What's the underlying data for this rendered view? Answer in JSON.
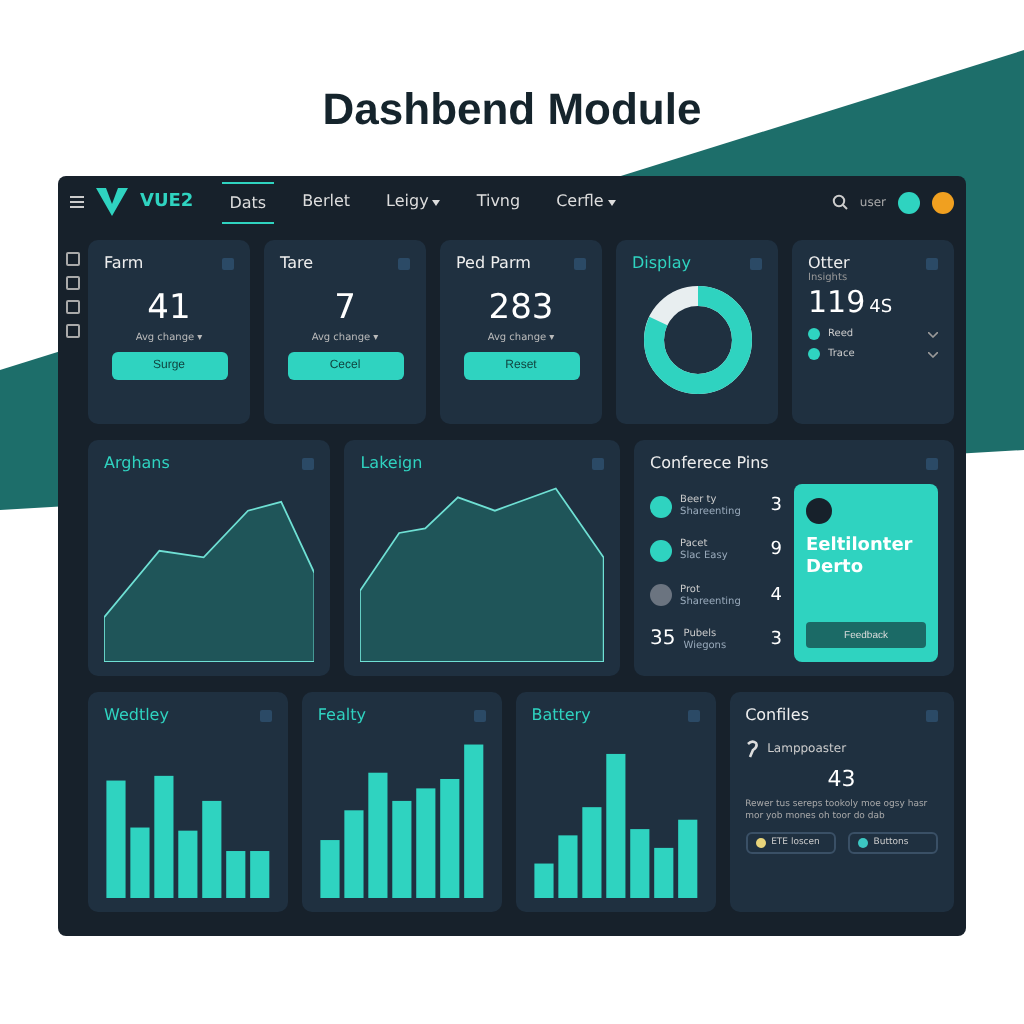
{
  "title": "Dashbend Module",
  "nav": {
    "brand": "VUE2",
    "tabs": [
      {
        "label": "Dats",
        "selected": true,
        "dropdown": false
      },
      {
        "label": "Berlet",
        "selected": false,
        "dropdown": false
      },
      {
        "label": "Leigy",
        "selected": false,
        "dropdown": true
      },
      {
        "label": "Tivng",
        "selected": false,
        "dropdown": false
      },
      {
        "label": "Cerfle",
        "selected": false,
        "dropdown": true
      }
    ],
    "user": "user"
  },
  "stat_cards": [
    {
      "title": "Farm",
      "value": "41",
      "caption": "Avg change ▾",
      "button": "Surge"
    },
    {
      "title": "Tare",
      "value": "7",
      "caption": "Avg change ▾",
      "button": "Cecel"
    },
    {
      "title": "Ped Parm",
      "value": "283",
      "caption": "Avg change ▾",
      "button": "Reset"
    }
  ],
  "donut_card": {
    "title": "Display",
    "level": 0.82
  },
  "other_card": {
    "title": "Otter",
    "subtitle": "Insights",
    "value": "119",
    "unit": "4S",
    "items": [
      {
        "label": "Reed"
      },
      {
        "label": "Trace"
      }
    ]
  },
  "area_cards": [
    {
      "title": "Arghans"
    },
    {
      "title": "Lakeign"
    }
  ],
  "list_card": {
    "title": "Conferece Pins",
    "items": [
      {
        "kind": "icon",
        "color": "#2fd3c0",
        "label": "Beer ty",
        "sub": "Shareenting",
        "count": "3"
      },
      {
        "kind": "icon",
        "color": "#2fd3c0",
        "label": "Pacet",
        "sub": "Slac Easy",
        "count": "9"
      },
      {
        "kind": "icon",
        "color": "#6b7480",
        "label": "Prot",
        "sub": "Shareenting",
        "count": "4"
      },
      {
        "kind": "number",
        "number": "35",
        "label": "Pubels",
        "sub": "Wiegons",
        "count": "3"
      }
    ],
    "promo": {
      "title": "Eeltilonter Derto",
      "button": "Feedback"
    }
  },
  "bar_cards": [
    {
      "title": "Wedtley"
    },
    {
      "title": "Fealty"
    },
    {
      "title": "Battery"
    }
  ],
  "info_card": {
    "title": "Confiles",
    "label": "Lamppoaster",
    "value": "43",
    "text": "Rewer tus sereps tookoly moe ogsy hasr mor yob mones oh toor do dab",
    "chips": [
      {
        "label": "ETE loscen",
        "color": "#e8d47a"
      },
      {
        "label": "Buttons",
        "color": "#3cc7c2"
      }
    ]
  }
}
